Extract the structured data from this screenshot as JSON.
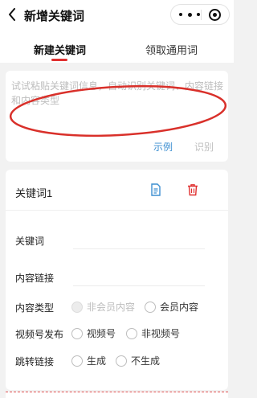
{
  "nav": {
    "title": "新增关键词",
    "back_icon": "chevron-left-icon",
    "more_icon": "more-dots-icon",
    "close_icon": "target-circle-icon"
  },
  "tabs": [
    {
      "label": "新建关键词",
      "active": true
    },
    {
      "label": "领取通用词",
      "active": false
    }
  ],
  "paste_box": {
    "placeholder": "试试粘贴关键词信息，自动识别关键词、内容链接和内容类型",
    "example_label": "示例",
    "identify_label": "识别"
  },
  "keyword_card": {
    "title": "关键词1",
    "edit_icon": "document-icon",
    "delete_icon": "trash-icon",
    "fields": {
      "keyword_label": "关键词",
      "keyword_value": "",
      "link_label": "内容链接",
      "link_value": ""
    },
    "content_type": {
      "label": "内容类型",
      "options": [
        "非会员内容",
        "会员内容"
      ]
    },
    "channel_publish": {
      "label": "视频号发布",
      "options": [
        "视频号",
        "非视频号"
      ]
    },
    "jump_link": {
      "label": "跳转链接",
      "options": [
        "生成",
        "不生成"
      ]
    }
  },
  "colors": {
    "accent_red": "#e03030",
    "link_blue": "#3d8fd1",
    "placeholder_gray": "#bdbdbd"
  }
}
